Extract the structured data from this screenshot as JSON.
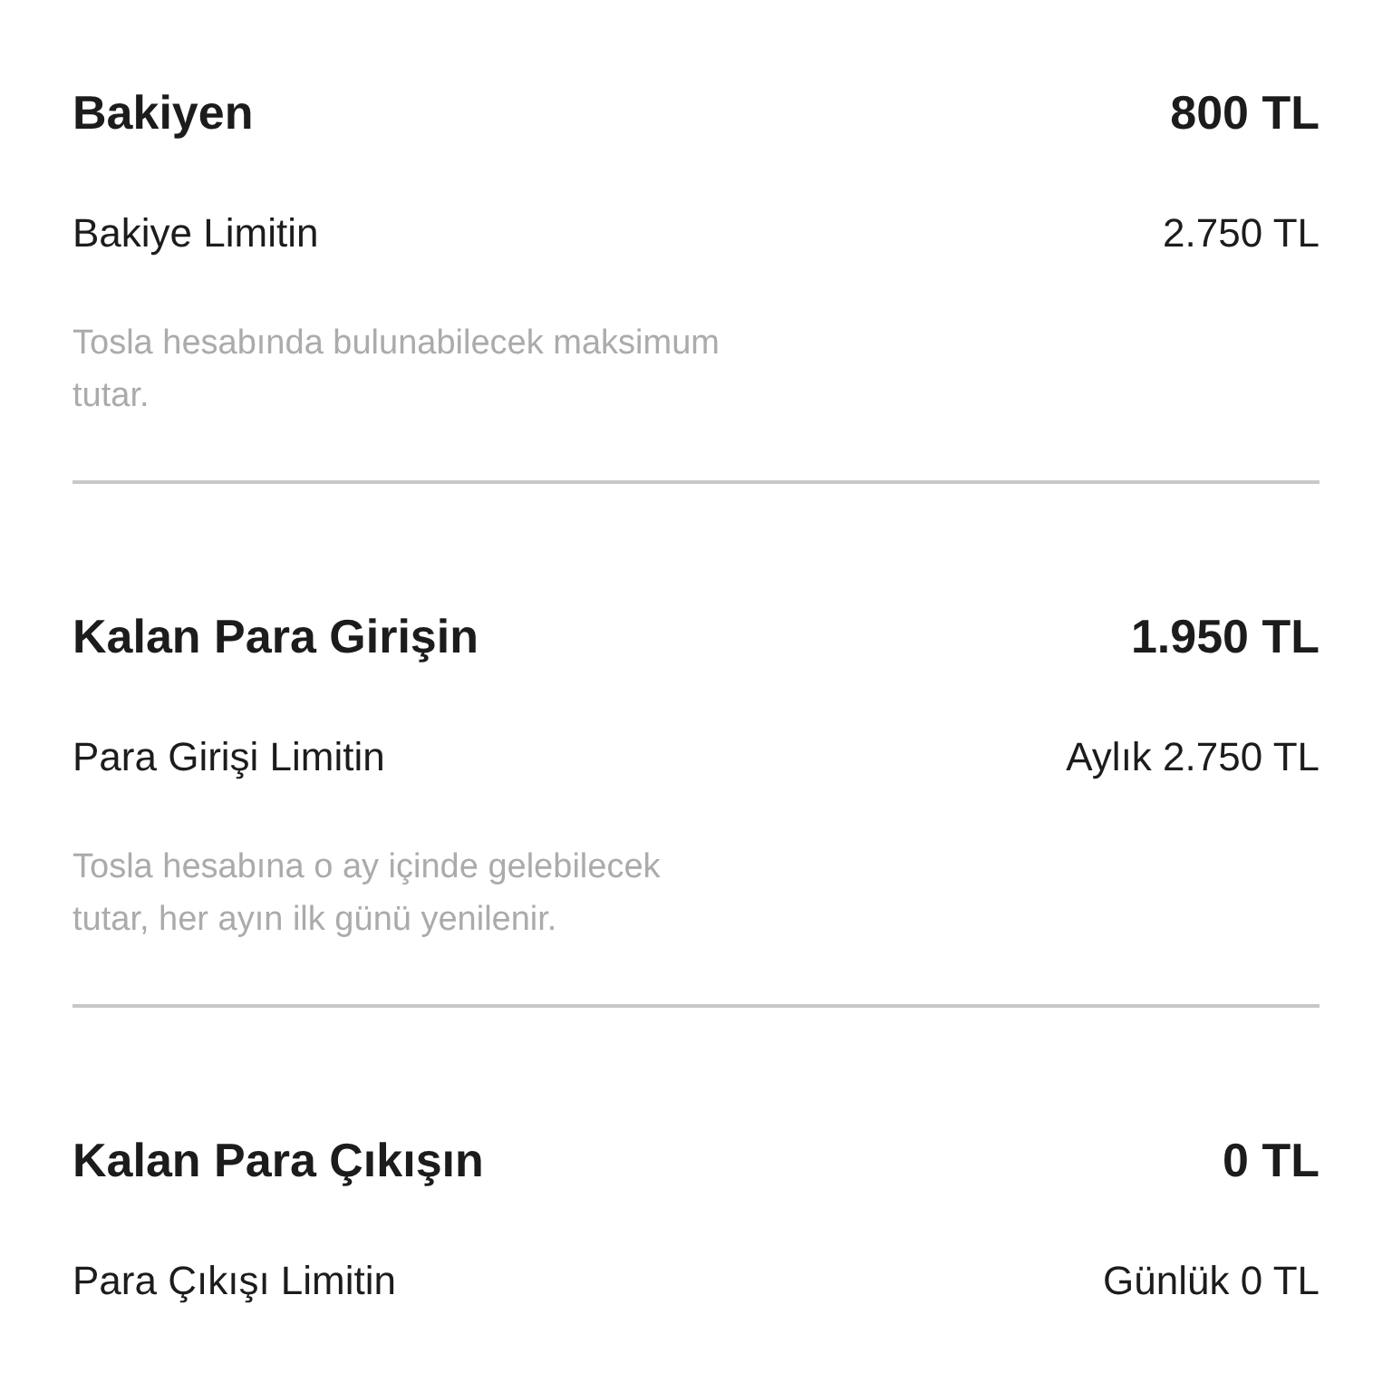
{
  "sections": [
    {
      "title": "Bakiyen",
      "value": "800 TL",
      "limit_label": "Bakiye Limitin",
      "limit_value": "2.750 TL",
      "description": "Tosla hesabında bulunabilecek maksimum tutar."
    },
    {
      "title": "Kalan Para Girişin",
      "value": "1.950 TL",
      "limit_label": "Para Girişi Limitin",
      "limit_value": "Aylık 2.750 TL",
      "description": "Tosla hesabına o ay içinde gelebilecek tutar, her ayın ilk günü yenilenir."
    },
    {
      "title": "Kalan Para Çıkışın",
      "value": "0 TL",
      "limit_label": "Para Çıkışı Limitin",
      "limit_value": "Günlük 0 TL"
    }
  ]
}
